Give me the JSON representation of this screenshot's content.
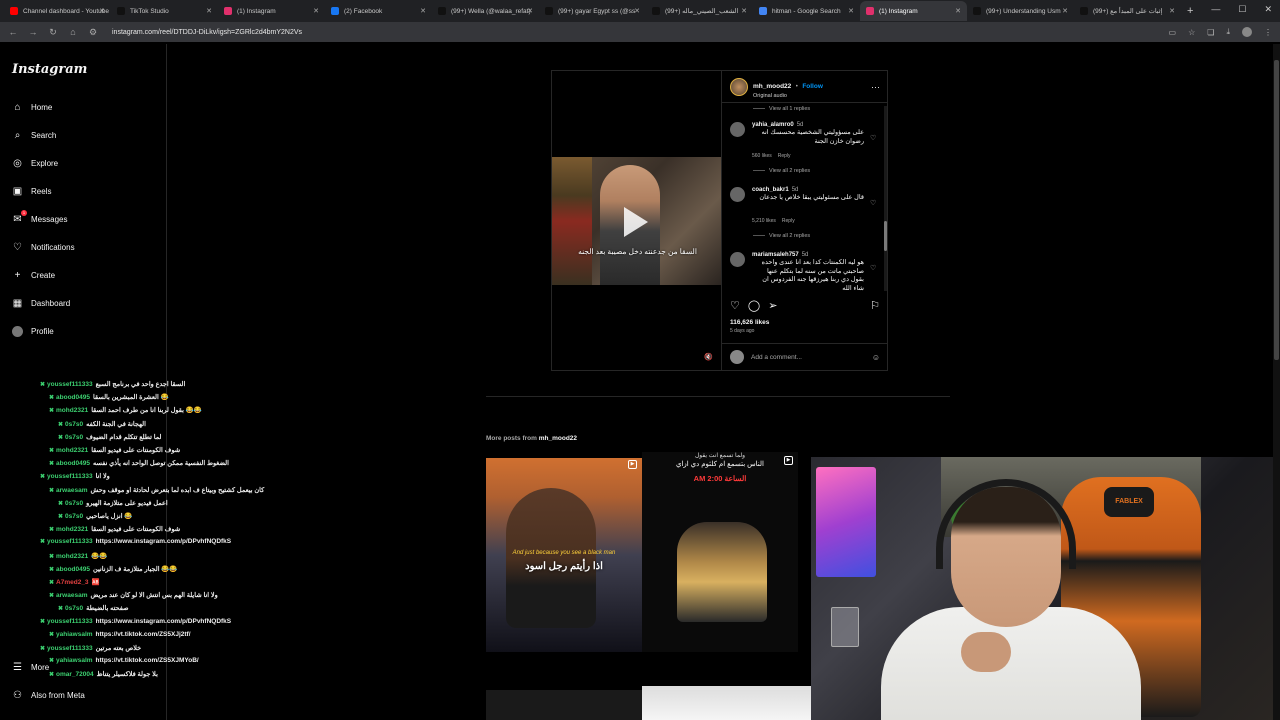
{
  "browser": {
    "tabs": [
      {
        "title": "Channel dashboard - Youtube",
        "color": "#ff0000"
      },
      {
        "title": "TikTok Studio",
        "color": "#111111"
      },
      {
        "title": "(1) Instagram",
        "color": "#e1306c"
      },
      {
        "title": "(2) Facebook",
        "color": "#1877f2"
      },
      {
        "title": "(99+) Wella (@walaa_refat)",
        "color": "#111111"
      },
      {
        "title": "(99+) gayar Egypt ss (@ss",
        "color": "#111111"
      },
      {
        "title": "(99+) الشعب_الصيني_ماله",
        "color": "#111111"
      },
      {
        "title": "hitman - Google Search",
        "color": "#4285f4"
      },
      {
        "title": "(1) Instagram",
        "color": "#e1306c"
      },
      {
        "title": "(99+) Understanding Usm",
        "color": "#111111"
      },
      {
        "title": "(99+) إثبات على المبدأ مع",
        "color": "#111111"
      }
    ],
    "url": "instagram.com/reel/DTDDJ-DiLkv/igsh=ZGRlc2d4bmY2N2Vs"
  },
  "sidebar": {
    "logo": "Instagram",
    "items": [
      {
        "label": "Home",
        "icon": "home-icon"
      },
      {
        "label": "Search",
        "icon": "search-icon"
      },
      {
        "label": "Explore",
        "icon": "compass-icon"
      },
      {
        "label": "Reels",
        "icon": "reels-icon"
      },
      {
        "label": "Messages",
        "icon": "messenger-icon",
        "badge": "1"
      },
      {
        "label": "Notifications",
        "icon": "heart-icon"
      },
      {
        "label": "Create",
        "icon": "plus-icon"
      },
      {
        "label": "Dashboard",
        "icon": "chart-icon"
      },
      {
        "label": "Profile",
        "icon": "avatar"
      }
    ],
    "more_label": "More",
    "meta_label": "Also from Meta"
  },
  "post": {
    "username": "mh_mood22",
    "follow_label": "Follow",
    "audio": "Original audio",
    "subtitle": "السقا من جدعنته دخل مصيبة بعد الجنه",
    "comments": [
      {
        "type": "replies",
        "label": "View all 1 replies"
      },
      {
        "type": "comment",
        "user": "yahia_alamro0",
        "age": "5d",
        "text": "على مسؤوليتي الشخصية محسسك انه رضوان خازن الجنة",
        "likes": "560 likes",
        "reply": "Reply"
      },
      {
        "type": "replies",
        "label": "View all 2 replies"
      },
      {
        "type": "comment",
        "user": "coach_bakr1",
        "age": "5d",
        "text": "قال على مسئوليتي يبقا خلاص يا جدعان",
        "likes": "5,210 likes",
        "reply": "Reply"
      },
      {
        "type": "replies",
        "label": "View all 2 replies"
      },
      {
        "type": "comment",
        "user": "mariamsaleh757",
        "age": "5d",
        "text": "هو ليه الكمنتات كدا بعد انا عندى واحده صاحبتي ماتت من سنه لما بتكلم عنها بقول دي ربنا هيرزقها جنه الفردوس ان شاء الله",
        "likes": "",
        "reply": ""
      }
    ],
    "likes": "116,626 likes",
    "ago": "5 days ago",
    "add_comment_placeholder": "Add a comment..."
  },
  "more_posts": {
    "prefix": "More posts from",
    "username": "mh_mood22",
    "thumb1_caption": "And just because you see a black man",
    "thumb1_arabic": "اذا رأيتم رجل اسود",
    "thumb2_line1": "ولما تسمع انت يقول",
    "thumb2_line2": "الناس بتسمع ام كلثوم دي ازاي",
    "thumb2_time": "AM 2:00 الساعة"
  },
  "chat": [
    {
      "user": "youssef111333",
      "msg": "السقا اجدع واحد في برنامج السبع",
      "indent": 0
    },
    {
      "user": "abood0495",
      "msg": "العشرة المبشرين بالسقا 😂",
      "indent": 1
    },
    {
      "user": "mohd2321",
      "msg": "بقول لربنا انا من طرف احمد السقا 😂😂",
      "indent": 1
    },
    {
      "user": "0s7s0",
      "msg": "الهجانة في الجنة الكفه",
      "indent": 2
    },
    {
      "user": "0s7s0",
      "msg": "لما تطلع تتكلم قدام الضيوف",
      "indent": 2
    },
    {
      "user": "mohd2321",
      "msg": "شوف الكومنتات على فيديو السقا",
      "indent": 1
    },
    {
      "user": "abood0495",
      "msg": "الضغوط النفسية ممكن توصل الواحد انه يأذي نفسه",
      "indent": 1
    },
    {
      "user": "youssef111333",
      "msg": "ولا انا",
      "indent": 0
    },
    {
      "user": "arwaesam",
      "msg": "كان بيعمل كشتيح وبيتاع ف ابده لما بتعرض لحادثة او موقف وحش",
      "indent": 1
    },
    {
      "user": "0s7s0",
      "msg": "اعمل فيديو على متلازمة الهيرو",
      "indent": 2
    },
    {
      "user": "0s7s0",
      "msg": "انزل ياصاحبي 😂",
      "indent": 2
    },
    {
      "user": "mohd2321",
      "msg": "شوف الكومنتات على فيديو السقا",
      "indent": 1
    },
    {
      "user": "youssef111333",
      "msg": "https://www.instagram.com/p/DPvhfNQDfkS",
      "indent": 0
    },
    {
      "user": "mohd2321",
      "msg": "😂😂",
      "indent": 1
    },
    {
      "user": "abood0495",
      "msg": "الجبار متلازمة ف الزنانين 😂😂",
      "indent": 1
    },
    {
      "user": "A7med2_3",
      "msg": "🆎",
      "indent": 1,
      "red": true
    },
    {
      "user": "arwaesam",
      "msg": "ولا انا شايلة الهم بس انتش الا لو كان عند مريض",
      "indent": 1
    },
    {
      "user": "0s7s0",
      "msg": "صفحته بالضيطة",
      "indent": 2
    },
    {
      "user": "youssef111333",
      "msg": "https://www.instagram.com/p/DPvhfNQDfkS",
      "indent": 0
    },
    {
      "user": "yahiawsalm",
      "msg": "https://vt.tiktok.com/ZS5XJj2tf/",
      "indent": 1
    },
    {
      "user": "youssef111333",
      "msg": "خلاص بعته مرتين",
      "indent": 0
    },
    {
      "user": "yahiawsalm",
      "msg": "https://vt.tiktok.com/ZS5XJMYoB/",
      "indent": 1
    },
    {
      "user": "omar_72004",
      "msg": "بلا جولة فلاكسيلر يتناظ",
      "indent": 1
    }
  ],
  "webcam": {
    "chair_brand": "FABLEX"
  },
  "colors": {
    "accent": "#0095f6",
    "chat_user": "#3cd070",
    "badge": "#ff3040"
  }
}
